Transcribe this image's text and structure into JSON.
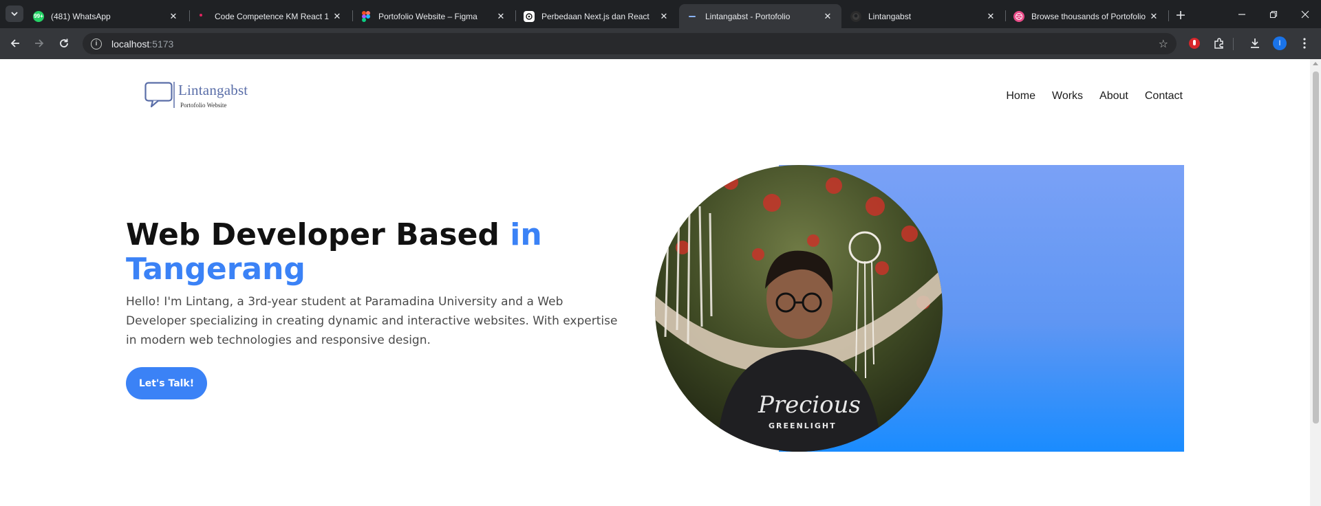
{
  "browser": {
    "tabs": [
      {
        "title": "(481) WhatsApp",
        "icon": "whatsapp-icon",
        "color": "#25d366",
        "badge": "99+"
      },
      {
        "title": "Code Competence KM React 1",
        "icon": "slides-icon",
        "color": "#e0245e"
      },
      {
        "title": "Portofolio Website – Figma",
        "icon": "figma-icon",
        "color": "#f24e1e"
      },
      {
        "title": "Perbedaan Next.js dan React",
        "icon": "openai-icon",
        "color": "#ffffff"
      },
      {
        "title": "Lintangabst - Portofolio",
        "icon": "page-icon",
        "color": "#8ab4f8",
        "active": true
      },
      {
        "title": "Lintangabst",
        "icon": "github-icon",
        "color": "#2b2b2b"
      },
      {
        "title": "Browse thousands of Portofolio",
        "icon": "dribbble-icon",
        "color": "#ea4c89"
      }
    ],
    "address": {
      "host": "localhost",
      "port": ":5173"
    },
    "profile_initial": "I"
  },
  "site": {
    "logo": {
      "name": "Lintangabst",
      "tagline": "Portofolio Website"
    },
    "nav": [
      "Home",
      "Works",
      "About",
      "Contact"
    ],
    "hero": {
      "title_main": "Web Developer Based ",
      "title_accent": "in Tangerang",
      "description": "Hello! I'm Lintang, a 3rd-year student at Paramadina University and a Web Developer specializing in creating dynamic and interactive websites. With expertise in modern web technologies and responsive design.",
      "cta_label": "Let's Talk!"
    },
    "colors": {
      "accent": "#3b82f6",
      "gradient_top": "#7aa1f6",
      "gradient_bottom": "#1a8cff"
    }
  }
}
